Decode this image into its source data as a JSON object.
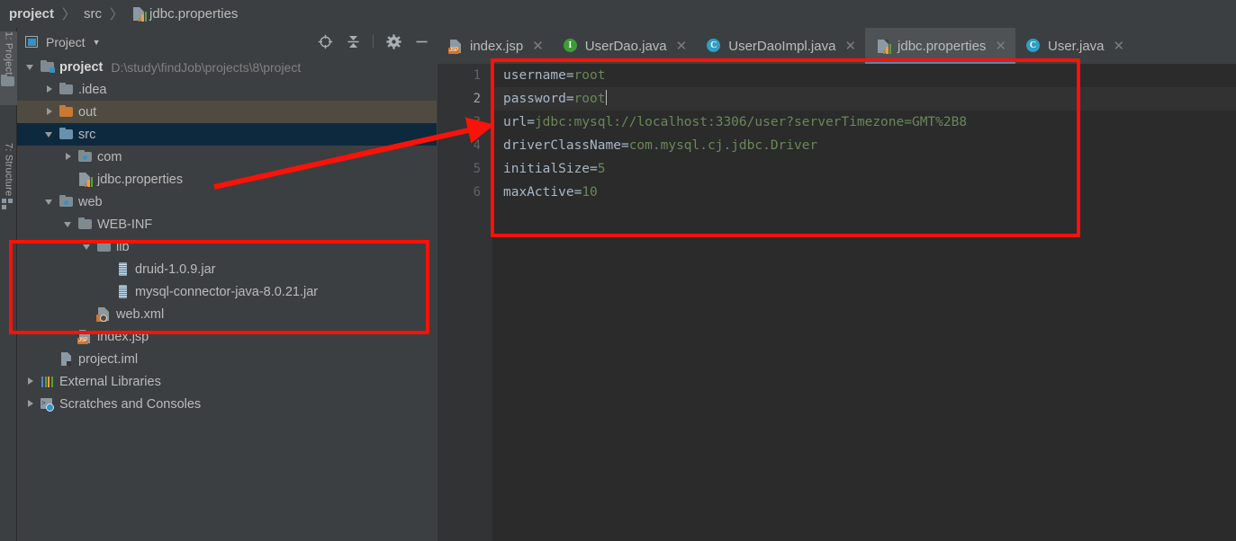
{
  "breadcrumb": {
    "items": [
      {
        "label": "project",
        "bold": true,
        "icon": ""
      },
      {
        "label": "src",
        "bold": false,
        "icon": ""
      },
      {
        "label": "jdbc.properties",
        "bold": false,
        "icon": "properties-file-icon"
      }
    ],
    "separator": "〉"
  },
  "tool_strip": {
    "project_tab": "1: Project",
    "structure_tab": "7: Structure"
  },
  "project_panel": {
    "title": "Project",
    "caret": "▼",
    "tools": [
      {
        "name": "locate-in-tree-icon",
        "glyph": "target"
      },
      {
        "name": "collapse-all-icon",
        "glyph": "collapse"
      },
      {
        "name": "settings-gear-icon",
        "glyph": "gear"
      },
      {
        "name": "hide-panel-icon",
        "glyph": "minus"
      }
    ]
  },
  "tree": [
    {
      "label": "project",
      "path": "D:\\study\\findJob\\projects\\8\\project",
      "indent": 0,
      "arrow": "down",
      "icon": "module-folder-icon",
      "bold": true,
      "highlight": ""
    },
    {
      "label": ".idea",
      "path": "",
      "indent": 1,
      "arrow": "right",
      "icon": "folder-gray-icon",
      "bold": false,
      "highlight": ""
    },
    {
      "label": "out",
      "path": "",
      "indent": 1,
      "arrow": "right",
      "icon": "folder-orange-icon",
      "bold": false,
      "highlight": "out"
    },
    {
      "label": "src",
      "path": "",
      "indent": 1,
      "arrow": "down",
      "icon": "source-folder-icon",
      "bold": false,
      "highlight": "src"
    },
    {
      "label": "com",
      "path": "",
      "indent": 2,
      "arrow": "right",
      "icon": "package-folder-icon",
      "bold": false,
      "highlight": ""
    },
    {
      "label": "jdbc.properties",
      "path": "",
      "indent": 2,
      "arrow": "none",
      "icon": "properties-file-icon",
      "bold": false,
      "highlight": ""
    },
    {
      "label": "web",
      "path": "",
      "indent": 1,
      "arrow": "down",
      "icon": "web-folder-icon",
      "bold": false,
      "highlight": ""
    },
    {
      "label": "WEB-INF",
      "path": "",
      "indent": 2,
      "arrow": "down",
      "icon": "folder-gray-icon",
      "bold": false,
      "highlight": ""
    },
    {
      "label": "lib",
      "path": "",
      "indent": 3,
      "arrow": "down",
      "icon": "folder-gray-icon",
      "bold": false,
      "highlight": ""
    },
    {
      "label": "druid-1.0.9.jar",
      "path": "",
      "indent": 4,
      "arrow": "none",
      "icon": "jar-file-icon",
      "bold": false,
      "highlight": ""
    },
    {
      "label": "mysql-connector-java-8.0.21.jar",
      "path": "",
      "indent": 4,
      "arrow": "none",
      "icon": "jar-file-icon",
      "bold": false,
      "highlight": ""
    },
    {
      "label": "web.xml",
      "path": "",
      "indent": 3,
      "arrow": "none",
      "icon": "xml-file-icon",
      "bold": false,
      "highlight": ""
    },
    {
      "label": "index.jsp",
      "path": "",
      "indent": 2,
      "arrow": "none",
      "icon": "jsp-file-icon",
      "bold": false,
      "highlight": ""
    },
    {
      "label": "project.iml",
      "path": "",
      "indent": 1,
      "arrow": "none",
      "icon": "iml-file-icon",
      "bold": false,
      "highlight": ""
    },
    {
      "label": "External Libraries",
      "path": "",
      "indent": 0,
      "arrow": "right",
      "icon": "external-libraries-icon",
      "bold": false,
      "highlight": ""
    },
    {
      "label": "Scratches and Consoles",
      "path": "",
      "indent": 0,
      "arrow": "right",
      "icon": "scratches-icon",
      "bold": false,
      "highlight": ""
    }
  ],
  "tabs": [
    {
      "label": "index.jsp",
      "icon": "jsp-file-icon",
      "active": false,
      "close": "✕"
    },
    {
      "label": "UserDao.java",
      "icon": "interface-icon",
      "letter": "I",
      "color": "#3d9c35",
      "active": false,
      "close": "✕"
    },
    {
      "label": "UserDaoImpl.java",
      "icon": "class-icon",
      "letter": "C",
      "color": "#2e9ec4",
      "active": false,
      "close": "✕"
    },
    {
      "label": "jdbc.properties",
      "icon": "properties-file-icon",
      "active": true,
      "close": "✕"
    },
    {
      "label": "User.java",
      "icon": "class-icon",
      "letter": "C",
      "color": "#2e9ec4",
      "active": false,
      "close": "✕"
    }
  ],
  "editor": {
    "file": "jdbc.properties",
    "current_line": 2,
    "lines": [
      {
        "no": "1",
        "key": "username",
        "sep": "=",
        "value": "root"
      },
      {
        "no": "2",
        "key": "password",
        "sep": "=",
        "value": "root"
      },
      {
        "no": "3",
        "key": "url",
        "sep": "=",
        "value": "jdbc:mysql://localhost:3306/user?serverTimezone=GMT%2B8"
      },
      {
        "no": "4",
        "key": "driverClassName",
        "sep": "=",
        "value": "com.mysql.cj.jdbc.Driver"
      },
      {
        "no": "5",
        "key": "initialSize",
        "sep": "=",
        "value": "5"
      },
      {
        "no": "6",
        "key": "maxActive",
        "sep": "=",
        "value": "10"
      }
    ]
  },
  "annotations": {
    "highlight_color": "#fb1208",
    "boxes": [
      "editor-content-box",
      "lib-folder-box"
    ],
    "arrow": "points-from-jdbc-properties-tree-node-to-editor-content"
  },
  "colors": {
    "background": "#3c3f41",
    "editor_background": "#2b2b2b",
    "accent": "#4a88c7",
    "text": "#bbbbbb",
    "string_value": "#6a8759",
    "annotation": "#fb1208"
  }
}
